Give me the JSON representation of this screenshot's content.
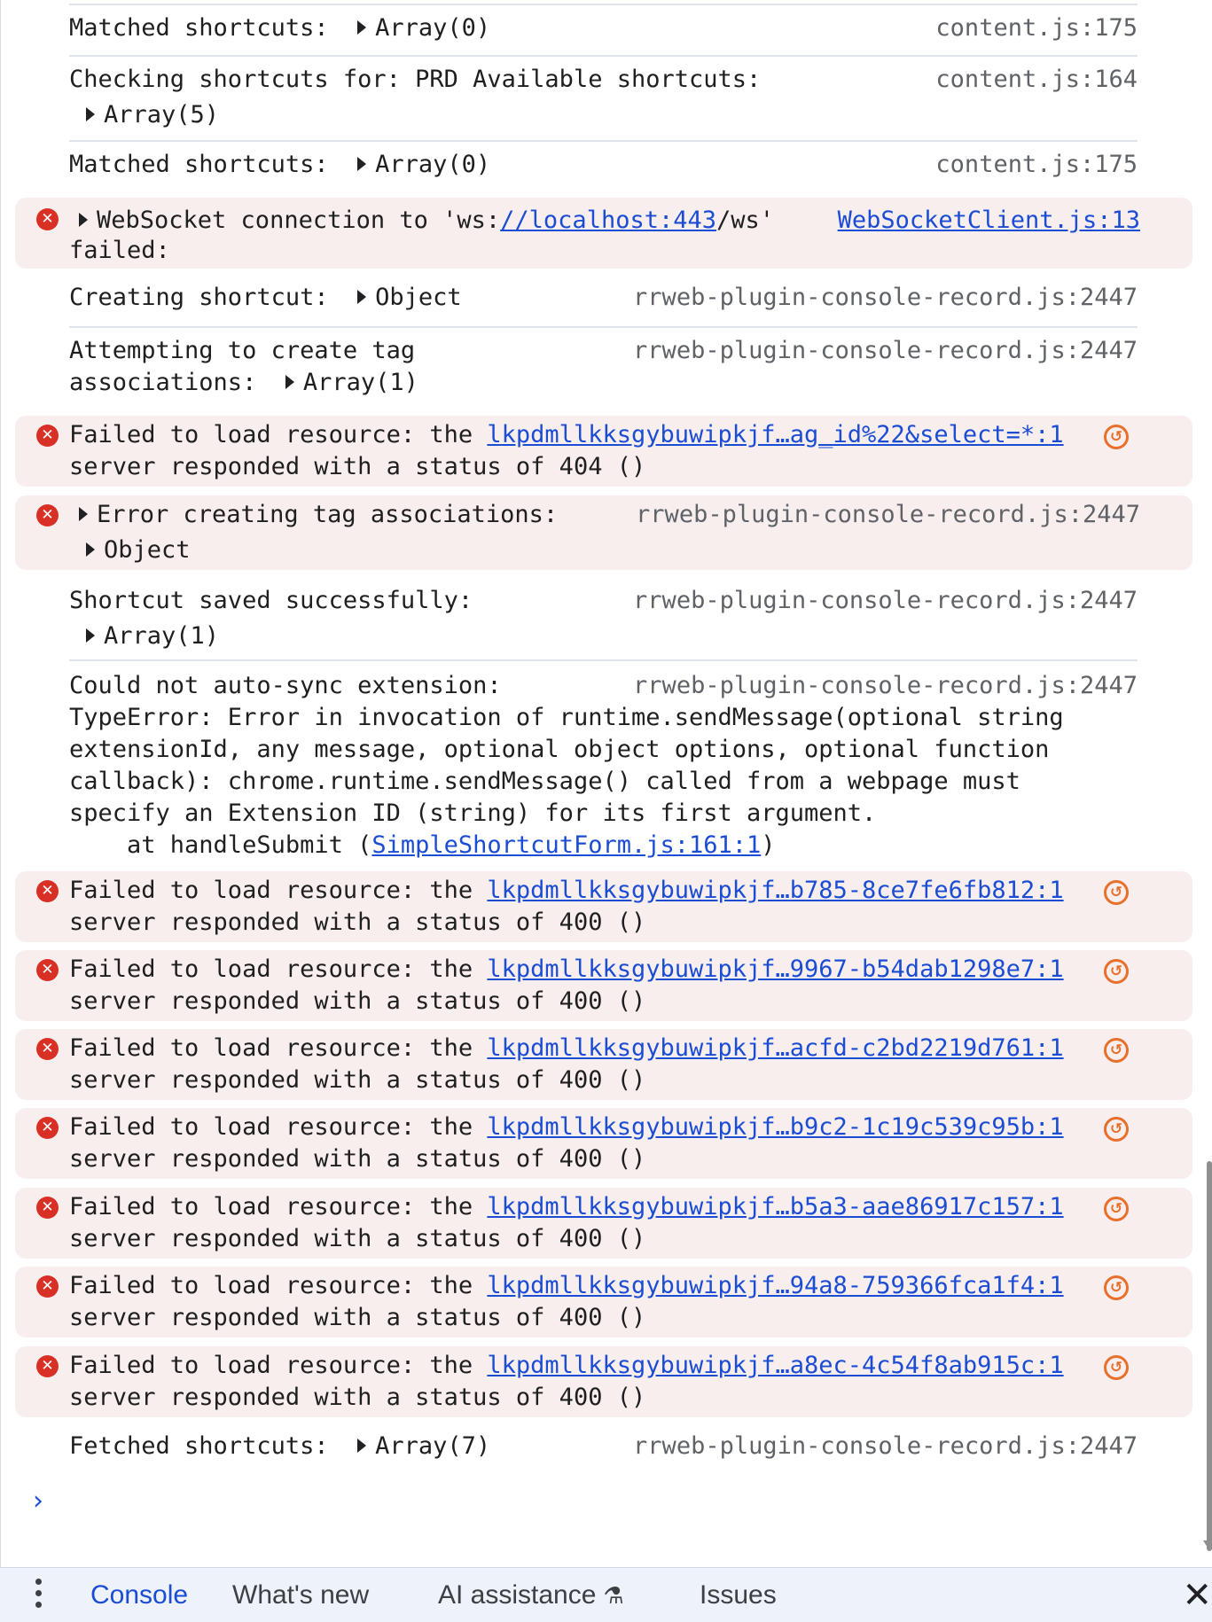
{
  "messages": [
    {
      "parts": [
        {
          "t": "Matched shortcuts:  "
        },
        {
          "caret": true
        },
        {
          "t": "Array(0)"
        }
      ],
      "source": "content.js:175"
    },
    {
      "lines": [
        "Checking shortcuts for: PRD Available shortcuts:"
      ],
      "expand": "Array(5)",
      "source": "content.js:164"
    },
    {
      "parts": [
        {
          "t": "Matched shortcuts:  "
        },
        {
          "caret": true
        },
        {
          "t": "Array(0)"
        }
      ],
      "source": "content.js:175"
    }
  ],
  "websocket_error": {
    "text_before": "WebSocket connection to 'ws:",
    "link": "//localhost:443",
    "text_after": "/ws'",
    "line2": "failed:",
    "source": "WebSocketClient.js:13"
  },
  "creating": {
    "text": "Creating shortcut:  ",
    "expand": "Object",
    "source": "rrweb-plugin-console-record.js:2447"
  },
  "attempting": {
    "line1": "Attempting to create tag",
    "line2": "associations:  ",
    "expand": "Array(1)",
    "source": "rrweb-plugin-console-record.js:2447"
  },
  "error_404": {
    "line1": "Failed to load resource: the ",
    "link": "lkpdmllkksgybuwipkjf…ag_id%22&select=*:1",
    "line2": "server responded with a status of 404 ()"
  },
  "tag_error": {
    "text": "Error creating tag associations:",
    "expand": "Object",
    "source": "rrweb-plugin-console-record.js:2447"
  },
  "saved": {
    "text": "Shortcut saved successfully:",
    "expand": "Array(1)",
    "source": "rrweb-plugin-console-record.js:2447"
  },
  "autosync": {
    "line1": "Could not auto-sync extension:",
    "source": "rrweb-plugin-console-record.js:2447",
    "line2": "TypeError: Error in invocation of runtime.sendMessage(optional string",
    "line3": "extensionId, any message, optional object options, optional function",
    "line4": "callback): chrome.runtime.sendMessage() called from a webpage must",
    "line5": "specify an Extension ID (string) for its first argument.",
    "line6_pre": "    at handleSubmit (",
    "line6_link": "SimpleShortcutForm.js:161:1",
    "line6_post": ")"
  },
  "errors_400": [
    {
      "prefix": "Failed to load resource: the ",
      "link": "lkpdmllkksgybuwipkjf…b785-8ce7fe6fb812:1",
      "line2": "server responded with a status of 400 ()"
    },
    {
      "prefix": "Failed to load resource: the ",
      "link": "lkpdmllkksgybuwipkjf…9967-b54dab1298e7:1",
      "line2": "server responded with a status of 400 ()"
    },
    {
      "prefix": "Failed to load resource: the ",
      "link": "lkpdmllkksgybuwipkjf…acfd-c2bd2219d761:1",
      "line2": "server responded with a status of 400 ()"
    },
    {
      "prefix": "Failed to load resource: the ",
      "link": "lkpdmllkksgybuwipkjf…b9c2-1c19c539c95b:1",
      "line2": "server responded with a status of 400 ()"
    },
    {
      "prefix": "Failed to load resource: the ",
      "link": "lkpdmllkksgybuwipkjf…b5a3-aae86917c157:1",
      "line2": "server responded with a status of 400 ()"
    },
    {
      "prefix": "Failed to load resource: the ",
      "link": "lkpdmllkksgybuwipkjf…94a8-759366fca1f4:1",
      "line2": "server responded with a status of 400 ()"
    },
    {
      "prefix": "Failed to load resource: the ",
      "link": "lkpdmllkksgybuwipkjf…a8ec-4c54f8ab915c:1",
      "line2": "server responded with a status of 400 ()"
    }
  ],
  "fetched": {
    "text": "Fetched shortcuts:  ",
    "expand": "Array(7)",
    "source": "rrweb-plugin-console-record.js:2447"
  },
  "prompt": "›",
  "drawer": {
    "tabs": [
      "Console",
      "What's new",
      "AI assistance",
      "Issues"
    ],
    "close": "✕"
  },
  "icons": {
    "error": "✕",
    "network": "↺"
  },
  "colors": {
    "error_bg": "#f8eeee",
    "error_icon": "#d93025",
    "link": "#1a4cd4",
    "network_icon": "#e8702a",
    "drawer_bg": "#eef2fb"
  }
}
